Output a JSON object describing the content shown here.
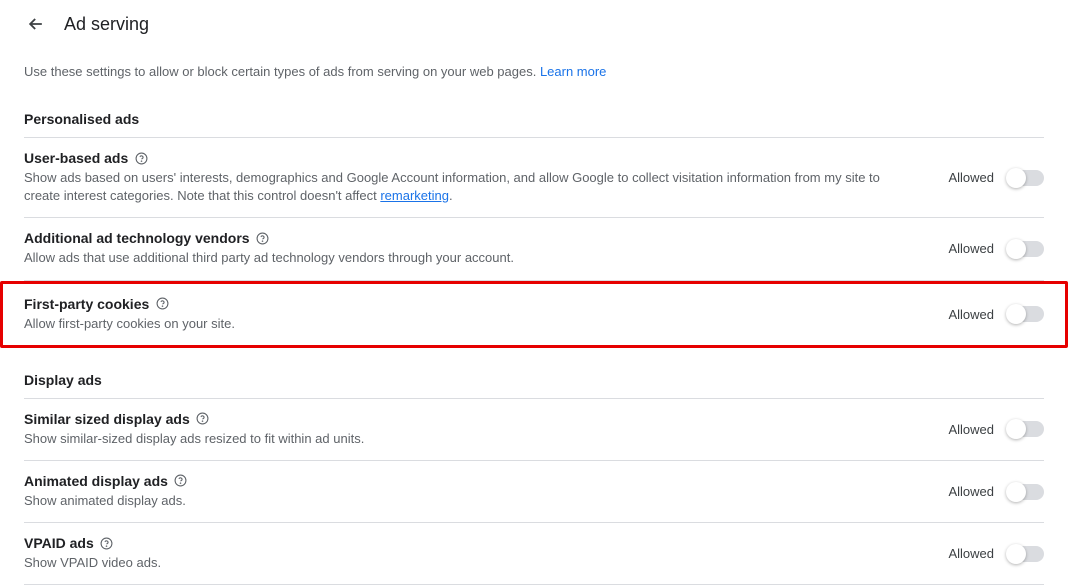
{
  "header": {
    "title": "Ad serving"
  },
  "description": {
    "text": "Use these settings to allow or block certain types of ads from serving on your web pages. ",
    "link": "Learn more"
  },
  "sections": {
    "personalised": {
      "title": "Personalised ads",
      "items": [
        {
          "title": "User-based ads",
          "desc_pre": "Show ads based on users' interests, demographics and Google Account information, and allow Google to collect visitation information from my site to create interest categories. Note that this control doesn't affect ",
          "link": "remarketing",
          "desc_post": ".",
          "status": "Allowed"
        },
        {
          "title": "Additional ad technology vendors",
          "desc": "Allow ads that use additional third party ad technology vendors through your account.",
          "status": "Allowed"
        },
        {
          "title": "First-party cookies",
          "desc": "Allow first-party cookies on your site.",
          "status": "Allowed"
        }
      ]
    },
    "display": {
      "title": "Display ads",
      "items": [
        {
          "title": "Similar sized display ads",
          "desc": "Show similar-sized display ads resized to fit within ad units.",
          "status": "Allowed"
        },
        {
          "title": "Animated display ads",
          "desc": "Show animated display ads.",
          "status": "Allowed"
        },
        {
          "title": "VPAID ads",
          "desc": "Show VPAID video ads.",
          "status": "Allowed"
        }
      ]
    }
  }
}
